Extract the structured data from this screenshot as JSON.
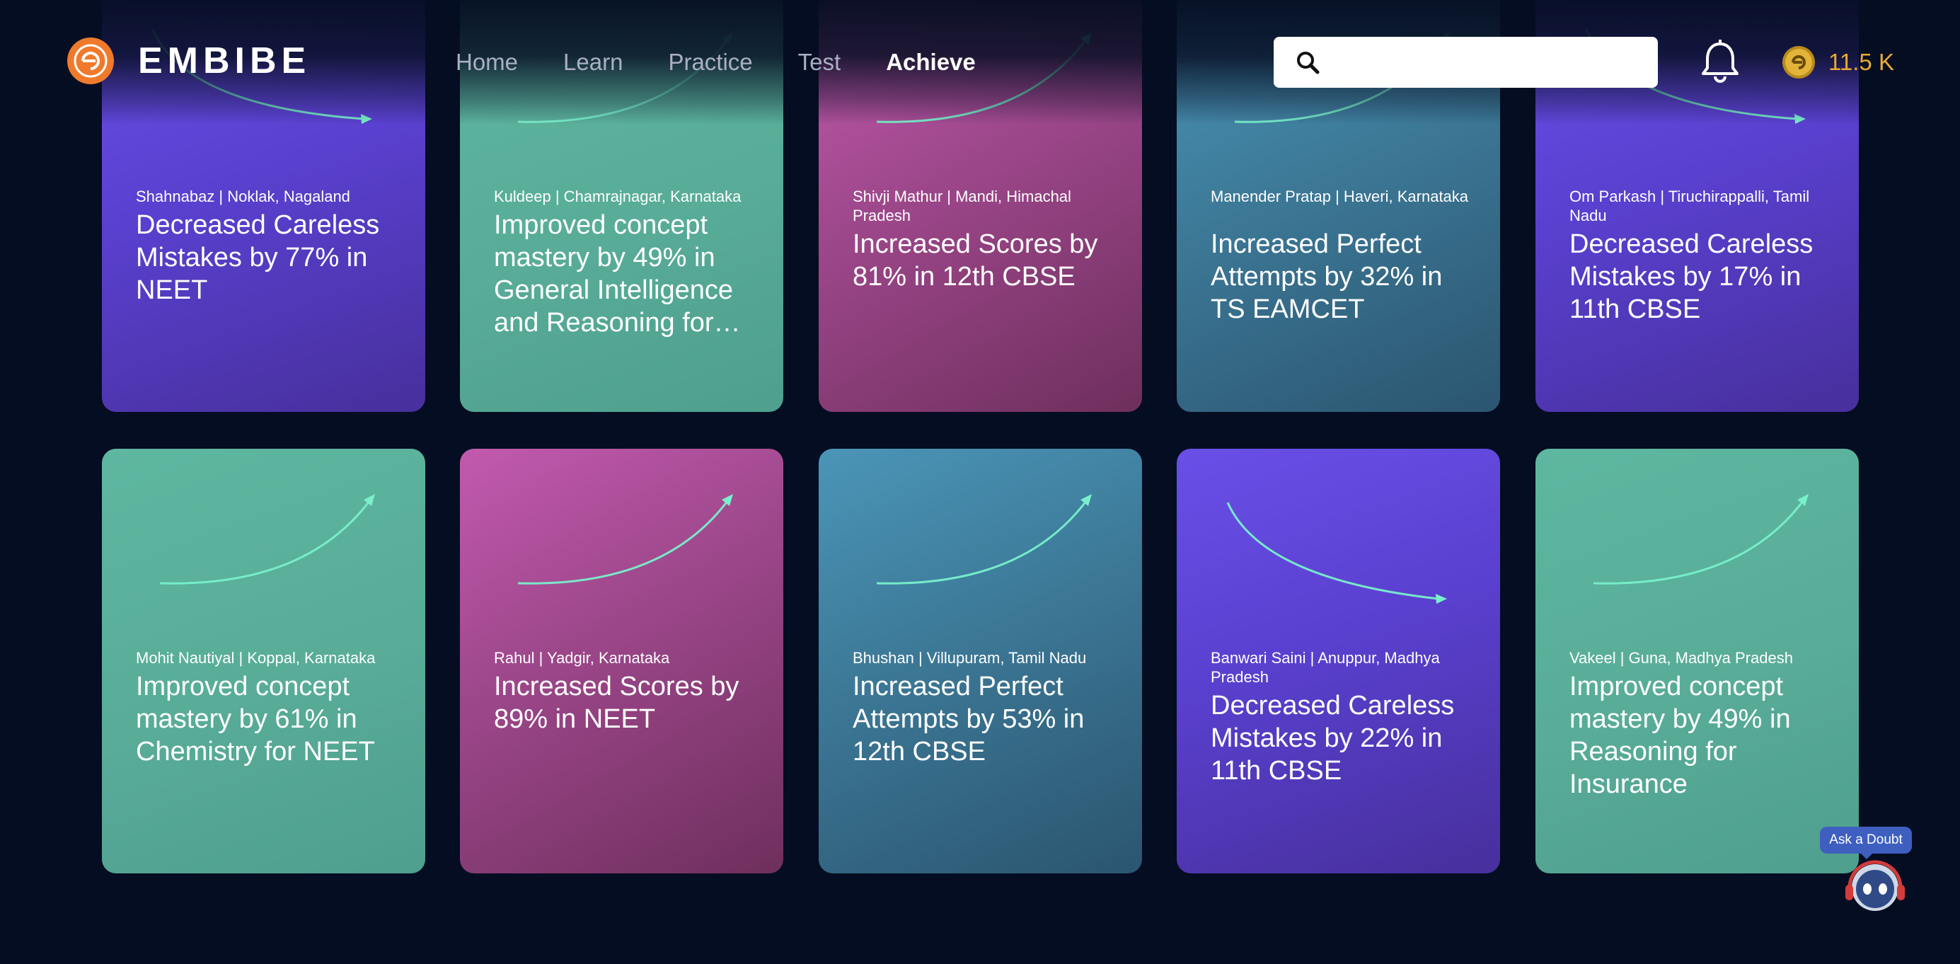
{
  "header": {
    "brand": "EMBIBE",
    "logo_icon": "embibe-logo-icon",
    "nav": [
      {
        "label": "Home",
        "active": false
      },
      {
        "label": "Learn",
        "active": false
      },
      {
        "label": "Practice",
        "active": false
      },
      {
        "label": "Test",
        "active": false
      },
      {
        "label": "Achieve",
        "active": true
      }
    ],
    "search": {
      "placeholder": "",
      "value": "",
      "icon": "search-icon"
    },
    "notifications_icon": "bell-icon",
    "coins": {
      "icon": "coin-icon",
      "value": "11.5 K",
      "color": "#e8a934"
    }
  },
  "colors": {
    "page_background": "#050d22",
    "arrow": "#79f0cb",
    "purple": "#5a40cf",
    "teal": "#58ac98",
    "pink": "#9b4689",
    "blue": "#3c7896"
  },
  "cards": [
    {
      "location": "Shahnabaz | Noklak, Nagaland",
      "title": "Decreased Careless Mistakes by 77% in NEET",
      "theme": "purple",
      "trend": "down"
    },
    {
      "location": "Kuldeep | Chamrajnagar, Karnataka",
      "title": "Improved concept mastery by 49% in General Intelligence and Reasoning for…",
      "theme": "teal",
      "trend": "up"
    },
    {
      "location": "Shivji Mathur | Mandi, Himachal Pradesh",
      "title": "Increased Scores by 81% in 12th CBSE",
      "theme": "pink",
      "trend": "up"
    },
    {
      "location": "Manender Pratap | Haveri, Karnataka",
      "title": "Increased Perfect Attempts by 32% in TS EAMCET",
      "theme": "blue",
      "trend": "up"
    },
    {
      "location": "Om Parkash | Tiruchirappalli, Tamil Nadu",
      "title": "Decreased Careless Mistakes by 17% in 11th CBSE",
      "theme": "purple",
      "trend": "down"
    },
    {
      "location": "Mohit Nautiyal | Koppal, Karnataka",
      "title": "Improved concept mastery by 61% in Chemistry for NEET",
      "theme": "teal",
      "trend": "up"
    },
    {
      "location": "Rahul | Yadgir, Karnataka",
      "title": "Increased Scores by 89% in NEET",
      "theme": "pink",
      "trend": "up"
    },
    {
      "location": "Bhushan | Villupuram, Tamil Nadu",
      "title": "Increased Perfect Attempts by 53% in 12th CBSE",
      "theme": "blue",
      "trend": "up"
    },
    {
      "location": "Banwari Saini | Anuppur, Madhya Pradesh",
      "title": "Decreased Careless Mistakes by 22% in 11th CBSE",
      "theme": "purple",
      "trend": "down"
    },
    {
      "location": "Vakeel | Guna, Madhya Pradesh",
      "title": "Improved concept mastery by 49% in Reasoning for Insurance",
      "theme": "teal",
      "trend": "up"
    }
  ],
  "ask_doubt": {
    "label": "Ask a Doubt",
    "icon": "robot-assistant-icon"
  }
}
